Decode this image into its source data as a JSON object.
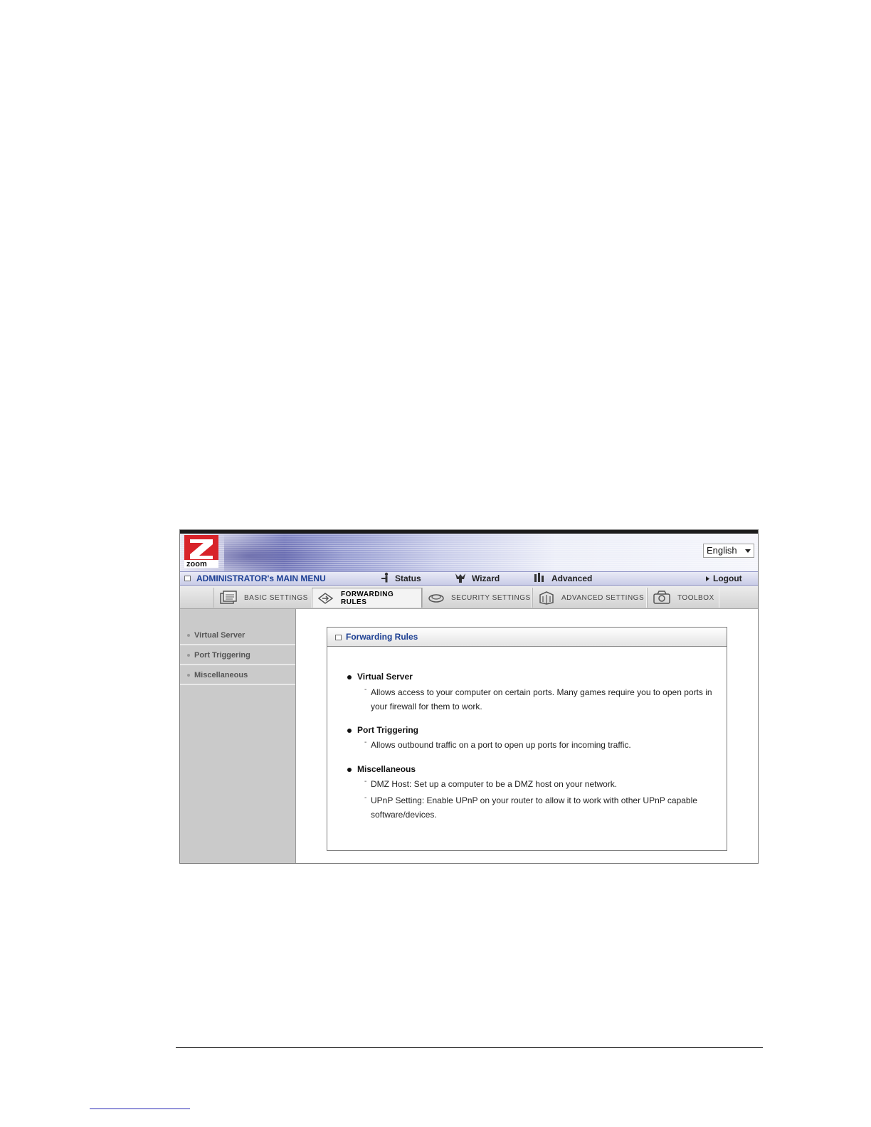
{
  "language": {
    "selected": "English"
  },
  "main_menu": {
    "title": "ADMINISTRATOR's MAIN MENU",
    "items": [
      {
        "label": "Status",
        "icon": "status-icon"
      },
      {
        "label": "Wizard",
        "icon": "wizard-icon"
      },
      {
        "label": "Advanced",
        "icon": "advanced-icon"
      }
    ],
    "logout": "Logout"
  },
  "tabs": [
    {
      "label": "BASIC SETTINGS",
      "icon": "basic-settings-icon",
      "active": false
    },
    {
      "label": "FORWARDING RULES",
      "icon": "forwarding-rules-icon",
      "active": true
    },
    {
      "label": "SECURITY SETTINGS",
      "icon": "security-settings-icon",
      "active": false
    },
    {
      "label": "ADVANCED SETTINGS",
      "icon": "advanced-settings-icon",
      "active": false
    },
    {
      "label": "TOOLBOX",
      "icon": "toolbox-icon",
      "active": false
    }
  ],
  "sidebar": {
    "items": [
      {
        "label": "Virtual Server"
      },
      {
        "label": "Port Triggering"
      },
      {
        "label": "Miscellaneous"
      }
    ]
  },
  "panel": {
    "title": "Forwarding Rules",
    "sections": [
      {
        "title": "Virtual Server",
        "descriptions": [
          "Allows access to your computer on certain ports. Many games require you to open ports in your firewall for them to work."
        ]
      },
      {
        "title": "Port Triggering",
        "descriptions": [
          "Allows outbound traffic on a port to open up ports for incoming traffic."
        ]
      },
      {
        "title": "Miscellaneous",
        "descriptions": [
          "DMZ Host: Set up a computer to be a DMZ host on your network.",
          "UPnP Setting: Enable UPnP on your router to allow it to work with other UPnP capable software/devices."
        ]
      }
    ]
  },
  "colors": {
    "menu_title": "#1c3f93",
    "logo_red": "#d8232a",
    "sidebar_bg": "#cacaca"
  }
}
